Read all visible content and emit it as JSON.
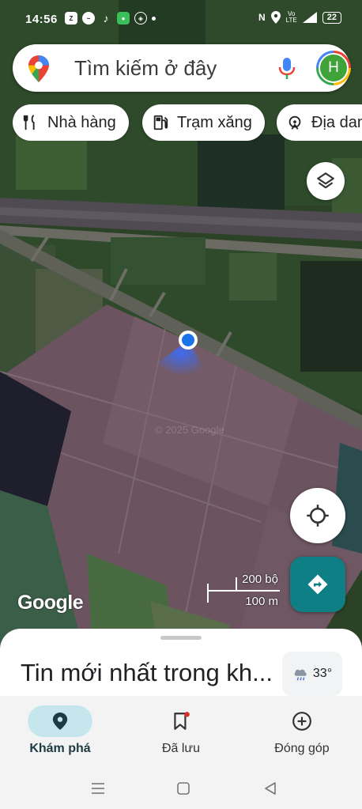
{
  "status_bar": {
    "time": "14:56",
    "left_icons": [
      "zalo-icon",
      "messenger-icon",
      "tiktok-icon",
      "wechat-icon",
      "vpn-icon"
    ],
    "right_icons": [
      "nfc-icon",
      "location-icon",
      "volte-icon",
      "signal-4g-icon"
    ],
    "battery": "22"
  },
  "search": {
    "placeholder": "Tìm kiếm ở đây",
    "avatar_letter": "H"
  },
  "chips": [
    {
      "label": "Nhà hàng",
      "icon": "restaurant-icon"
    },
    {
      "label": "Trạm xăng",
      "icon": "gas-station-icon"
    },
    {
      "label": "Địa dan",
      "icon": "attractions-icon"
    }
  ],
  "map": {
    "watermark": "© 2025 Google",
    "logo": "Google",
    "scale_top": "200 bộ",
    "scale_bottom": "100 m",
    "controls": [
      "layers-icon",
      "my-location-icon",
      "directions-icon"
    ]
  },
  "sheet": {
    "headline": "Tin mới nhất trong kh...",
    "temperature": "33°",
    "weather_icon": "rain-cloud-icon"
  },
  "nav": [
    {
      "label": "Khám phá",
      "icon": "explore-pin-icon",
      "active": true
    },
    {
      "label": "Đã lưu",
      "icon": "bookmark-icon",
      "active": false
    },
    {
      "label": "Đóng góp",
      "icon": "add-circle-icon",
      "active": false
    }
  ],
  "colors": {
    "accent_blue": "#1a73e8",
    "directions_teal": "#0f7f86",
    "nav_active_pill": "#c6e6ee"
  }
}
